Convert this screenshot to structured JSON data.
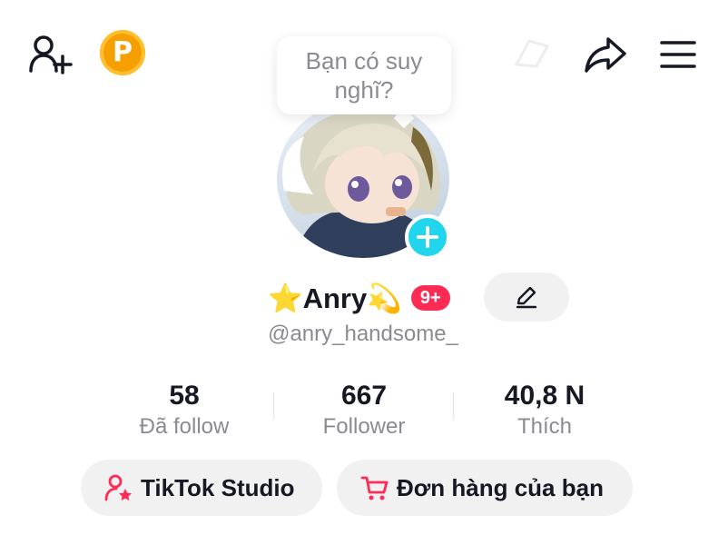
{
  "topbar": {
    "add_friend_icon": "add-user-icon",
    "coin_label": "P",
    "coin_color": "#f5a000",
    "faded_icon": "unknown-faded-icon",
    "share_icon": "share-arrow-icon",
    "menu_icon": "hamburger-menu-icon"
  },
  "bubble": {
    "line1": "Bạn có suy",
    "line2": "nghĩ?"
  },
  "profile": {
    "avatar_add_icon": "plus-icon",
    "avatar_add_color": "#20d5ec",
    "name": "⭐Anry💫",
    "badge": "9+",
    "badge_color": "#fe2c55",
    "edit_icon": "pencil-icon",
    "username": "@anry_handsome_"
  },
  "stats": [
    {
      "value": "58",
      "label": "Đã follow"
    },
    {
      "value": "667",
      "label": "Follower"
    },
    {
      "value": "40,8 N",
      "label": "Thích"
    }
  ],
  "actions": {
    "studio_label": "TikTok Studio",
    "studio_icon": "user-star-icon",
    "orders_label": "Đơn hàng của bạn",
    "orders_icon": "shopping-cart-icon",
    "accent_color": "#fe2c55"
  }
}
